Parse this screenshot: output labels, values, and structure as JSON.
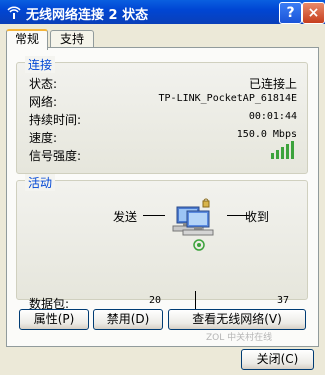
{
  "window": {
    "title": "无线网络连接 2 状态",
    "help_label": "?",
    "close_label": "×"
  },
  "tabs": [
    {
      "label": "常规"
    },
    {
      "label": "支持"
    }
  ],
  "connection": {
    "group_title": "连接",
    "rows": [
      {
        "label": "状态:",
        "value": "已连接上"
      },
      {
        "label": "网络:",
        "value": "TP-LINK_PocketAP_61814E"
      },
      {
        "label": "持续时间:",
        "value": "00:01:44"
      },
      {
        "label": "速度:",
        "value": "150.0 Mbps"
      },
      {
        "label": "信号强度:",
        "value": ""
      }
    ],
    "signal_bars": 5
  },
  "activity": {
    "group_title": "活动",
    "sent_label": "发送",
    "received_label": "收到",
    "packets_label": "数据包:",
    "packets_sent": "20",
    "packets_received": "37"
  },
  "buttons": {
    "properties": "属性(P)",
    "disable": "禁用(D)",
    "view_wireless": "查看无线网络(V)",
    "close": "关闭(C)"
  },
  "watermark": "ZOL 中关村在线"
}
